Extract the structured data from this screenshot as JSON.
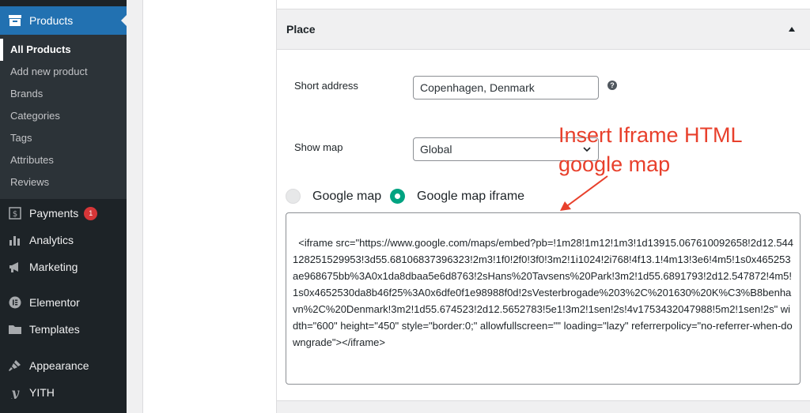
{
  "sidebar": {
    "products_label": "Products",
    "submenu": [
      "All Products",
      "Add new product",
      "Brands",
      "Categories",
      "Tags",
      "Attributes",
      "Reviews"
    ],
    "payments_label": "Payments",
    "payments_badge": "1",
    "analytics_label": "Analytics",
    "marketing_label": "Marketing",
    "elementor_label": "Elementor",
    "templates_label": "Templates",
    "appearance_label": "Appearance",
    "yith_label": "YITH"
  },
  "place": {
    "title": "Place",
    "short_address_label": "Short address",
    "short_address_value": "Copenhagen, Denmark",
    "help_glyph": "?",
    "show_map_label": "Show map",
    "show_map_value": "Global",
    "radio_google_map": "Google map",
    "radio_google_map_iframe": "Google map iframe",
    "iframe_code": "<iframe src=\"https://www.google.com/maps/embed?pb=!1m28!1m12!1m3!1d13915.067610092658!2d12.544128251529953!3d55.68106837396323!2m3!1f0!2f0!3f0!3m2!1i1024!2i768!4f13.1!4m13!3e6!4m5!1s0x465253ae968675bb%3A0x1da8dbaa5e6d8763!2sHans%20Tavsens%20Park!3m2!1d55.6891793!2d12.547872!4m5!1s0x4652530da8b46f25%3A0x6dfe0f1e98988f0d!2sVesterbrogade%203%2C%201630%20K%C3%B8benhavn%2C%20Denmark!3m2!1d55.674523!2d12.5652783!5e1!3m2!1sen!2s!4v1753432047988!5m2!1sen!2s\" width=\"600\" height=\"450\" style=\"border:0;\" allowfullscreen=\"\" loading=\"lazy\" referrerpolicy=\"no-referrer-when-downgrade\"></iframe>"
  },
  "annotation": {
    "line1": "Insert Iframe HTML",
    "line2": "google map"
  },
  "colors": {
    "sidebar_bg": "#1d2327",
    "accent": "#2271b1",
    "radio_on": "#00a381",
    "annotation": "#e8402c",
    "badge": "#d63638"
  }
}
